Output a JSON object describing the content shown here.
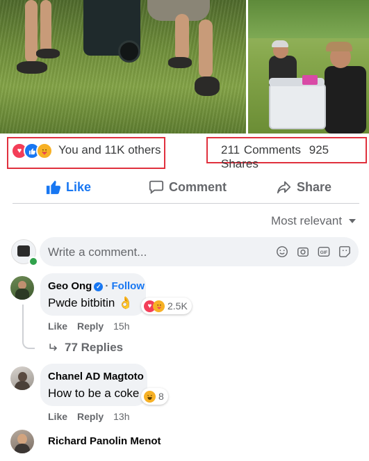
{
  "post": {
    "reaction_summary": "You and 11K others",
    "comments_count": "211 Comments",
    "shares_count": "925 Shares",
    "reaction_icons": [
      "love-icon",
      "like-icon",
      "care-icon"
    ]
  },
  "actions": {
    "like": "Like",
    "comment": "Comment",
    "share": "Share"
  },
  "sort_label": "Most relevant",
  "composer": {
    "placeholder": "Write a comment...",
    "icons": [
      "emoji-icon",
      "camera-icon",
      "gif-icon",
      "sticker-icon"
    ],
    "gif_text": "GIF"
  },
  "comments": [
    {
      "author": "Geo Ong",
      "follow": "Follow",
      "text": "Pwde bitbitin",
      "text_emoji": "👌",
      "reaction_count": "2.5K",
      "like": "Like",
      "reply": "Reply",
      "time": "15h",
      "replies": "77 Replies"
    },
    {
      "author": "Chanel AD Magtoto",
      "text": "How to be a coke",
      "reaction_count": "8",
      "like": "Like",
      "reply": "Reply",
      "time": "13h"
    },
    {
      "author": "Richard Panolin Menot"
    }
  ],
  "colors": {
    "accent": "#1877f2",
    "highlight_box": "#e0303d",
    "love": "#f33e58",
    "haha": "#f7b125"
  }
}
